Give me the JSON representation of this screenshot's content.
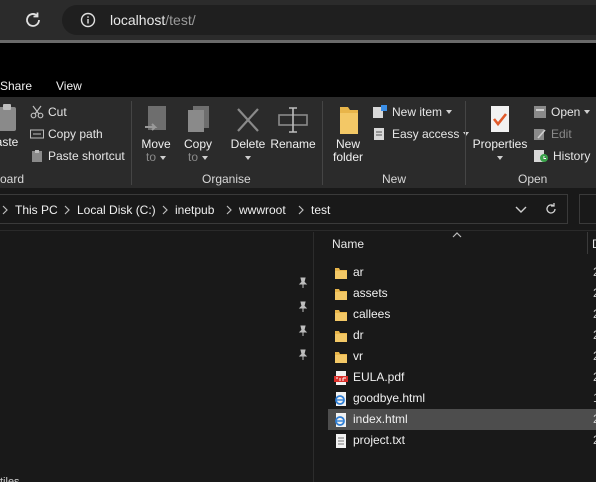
{
  "browser": {
    "url_host": "localhost",
    "url_path": "/test/"
  },
  "ribbon": {
    "tabs": [
      "Share",
      "View"
    ],
    "clipboard": {
      "paste_label": "aste",
      "cut_label": "Cut",
      "copy_path_label": "Copy path",
      "paste_shortcut_label": "Paste shortcut",
      "group_label": "oard"
    },
    "organise": {
      "move_to_line1": "Move",
      "move_to_line2": "to",
      "copy_to_line1": "Copy",
      "copy_to_line2": "to",
      "delete_label": "Delete",
      "rename_label": "Rename",
      "group_label": "Organise"
    },
    "new": {
      "new_folder_line1": "New",
      "new_folder_line2": "folder",
      "new_item_label": "New item",
      "easy_access_label": "Easy access",
      "group_label": "New"
    },
    "open": {
      "properties_label": "Properties",
      "open_label": "Open",
      "edit_label": "Edit",
      "history_label": "History",
      "group_label": "Open"
    }
  },
  "breadcrumb": [
    "This PC",
    "Local Disk (C:)",
    "inetpub",
    "wwwroot",
    "test"
  ],
  "filelist": {
    "col_name": "Name",
    "col_date": "D",
    "items": [
      {
        "name": "ar",
        "type": "folder",
        "date": "2"
      },
      {
        "name": "assets",
        "type": "folder",
        "date": "2"
      },
      {
        "name": "callees",
        "type": "folder",
        "date": "2"
      },
      {
        "name": "dr",
        "type": "folder",
        "date": "2"
      },
      {
        "name": "vr",
        "type": "folder",
        "date": "2"
      },
      {
        "name": "EULA.pdf",
        "type": "pdf",
        "date": "2"
      },
      {
        "name": "goodbye.html",
        "type": "html",
        "date": "1"
      },
      {
        "name": "index.html",
        "type": "html",
        "date": "2",
        "selected": true
      },
      {
        "name": "project.txt",
        "type": "txt",
        "date": "2"
      }
    ]
  },
  "status": {
    "items_text": "tiles"
  },
  "colors": {
    "background": "#191919",
    "ribbon": "#2b2b2b",
    "folder": "#e8b54a",
    "selection": "#4d4d4d"
  }
}
